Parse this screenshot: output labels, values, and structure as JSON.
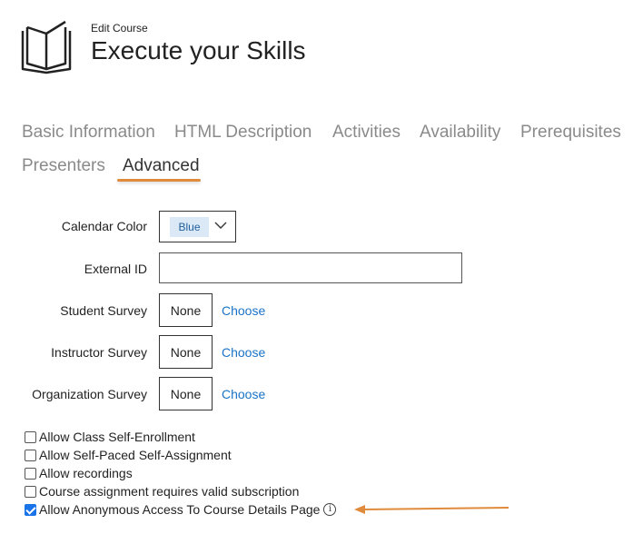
{
  "header": {
    "subtitle": "Edit Course",
    "title": "Execute your Skills",
    "icon": "book-icon"
  },
  "tabs": [
    {
      "label": "Basic Information",
      "active": false
    },
    {
      "label": "HTML Description",
      "active": false
    },
    {
      "label": "Activities",
      "active": false
    },
    {
      "label": "Availability",
      "active": false
    },
    {
      "label": "Prerequisites",
      "active": false
    },
    {
      "label": "Presenters",
      "active": false
    },
    {
      "label": "Advanced",
      "active": true
    }
  ],
  "form": {
    "calendar_color": {
      "label": "Calendar Color",
      "value": "Blue"
    },
    "external_id": {
      "label": "External ID",
      "value": ""
    },
    "student_survey": {
      "label": "Student Survey",
      "value": "None",
      "action": "Choose"
    },
    "instructor_survey": {
      "label": "Instructor Survey",
      "value": "None",
      "action": "Choose"
    },
    "organization_survey": {
      "label": "Organization Survey",
      "value": "None",
      "action": "Choose"
    }
  },
  "options": [
    {
      "label": "Allow Class Self-Enrollment",
      "checked": false
    },
    {
      "label": "Allow Self-Paced Self-Assignment",
      "checked": false
    },
    {
      "label": "Allow recordings",
      "checked": false
    },
    {
      "label": "Course assignment requires valid subscription",
      "checked": false
    },
    {
      "label": "Allow Anonymous Access To Course Details Page",
      "checked": true,
      "info": "i"
    }
  ],
  "colors": {
    "accent": "#e08a3c",
    "link": "#1a73c7",
    "checkbox": "#1a73e8",
    "chip_bg": "#dbe9f7"
  }
}
